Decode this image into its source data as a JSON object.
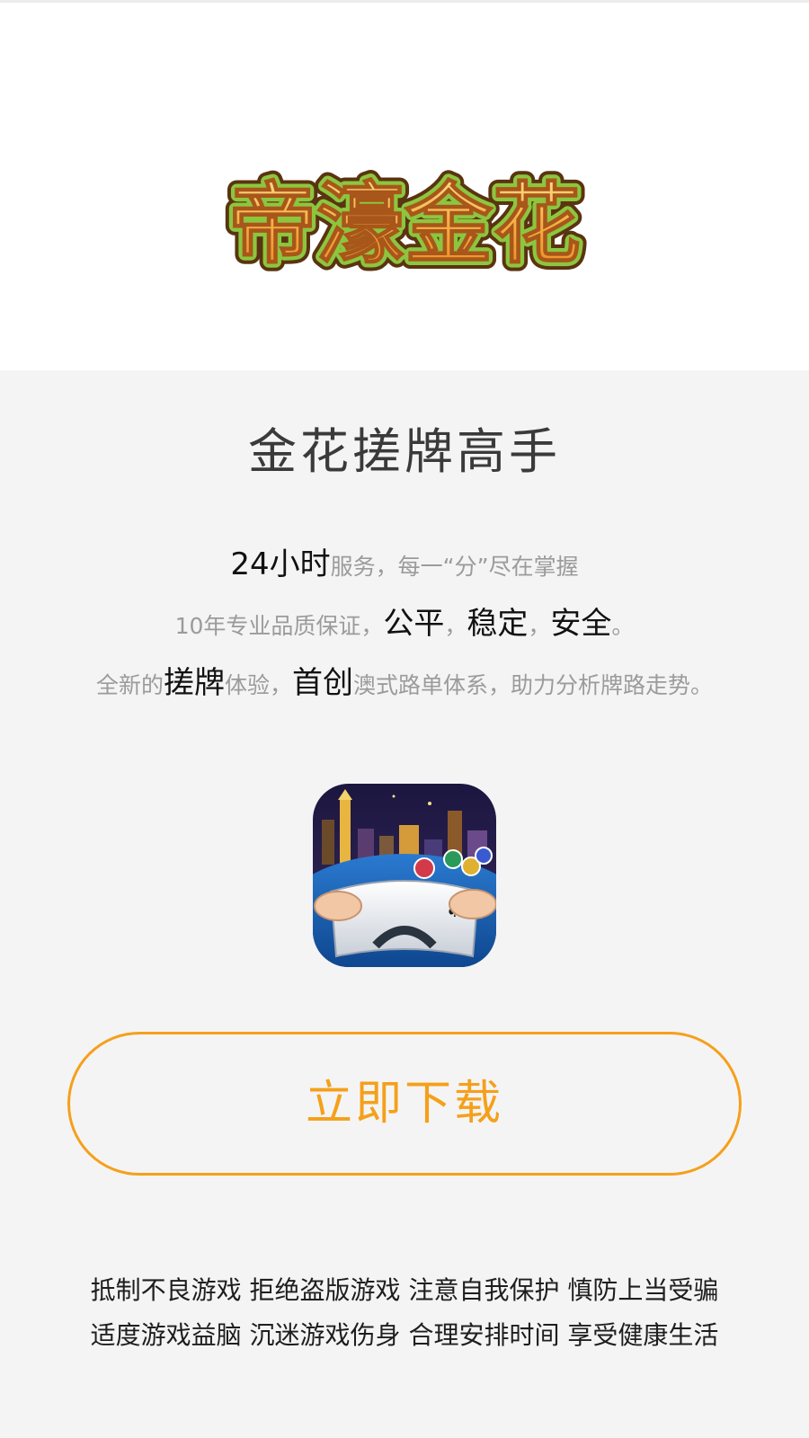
{
  "brand": {
    "logo_text": "帝濠金花",
    "colors": {
      "accent": "#f5a01a",
      "logo_fill": "#f6a93b",
      "logo_outline": "#8cc63f"
    }
  },
  "hero": {
    "headline": "金花搓牌高手"
  },
  "taglines": {
    "line1": {
      "highlight1": "24小时",
      "rest": "服务，每一“分”尽在掌握"
    },
    "line2": {
      "lead": "10年专业品质保证，",
      "highlight1": "公平",
      "sep1": "，",
      "highlight2": "稳定",
      "sep2": "，",
      "highlight3": "安全",
      "end": "。"
    },
    "line3": {
      "lead": "全新的",
      "highlight1": "搓牌",
      "mid1": "体验，",
      "highlight2": "首创",
      "rest": "澳式路单体系，助力分析牌路走势。"
    }
  },
  "app_icon": {
    "icon": "card-game-app-icon"
  },
  "actions": {
    "download_label": "立即下载"
  },
  "notice": {
    "line1": "抵制不良游戏 拒绝盗版游戏 注意自我保护 慎防上当受骗",
    "line2": "适度游戏益脑 沉迷游戏伤身 合理安排时间 享受健康生活"
  }
}
